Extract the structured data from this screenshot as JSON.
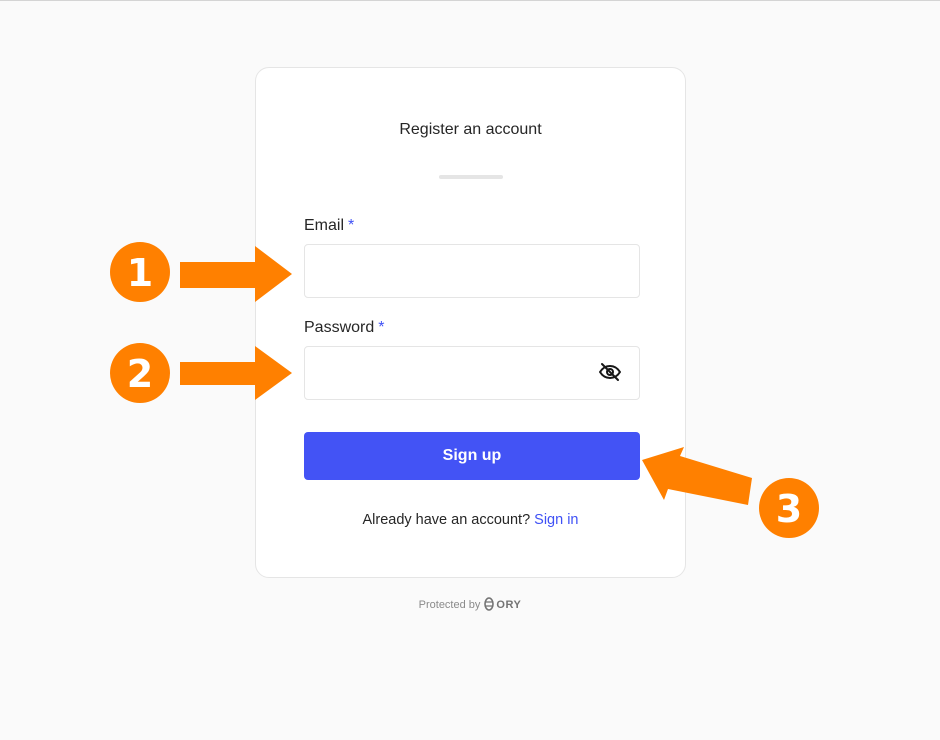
{
  "form": {
    "title": "Register an account",
    "email_label": "Email",
    "password_label": "Password",
    "required_mark": "*",
    "email_value": "",
    "password_value": "",
    "submit_label": "Sign up",
    "signin_prompt": "Already have an account?",
    "signin_link": "Sign in"
  },
  "footer": {
    "protected_by": "Protected by",
    "brand": "ORY"
  },
  "annotations": {
    "marker_1": "1",
    "marker_2": "2",
    "marker_3": "3",
    "color": "#ff8000"
  },
  "colors": {
    "accent": "#4353f5",
    "link": "#3f51f5",
    "background": "#fafafa"
  }
}
